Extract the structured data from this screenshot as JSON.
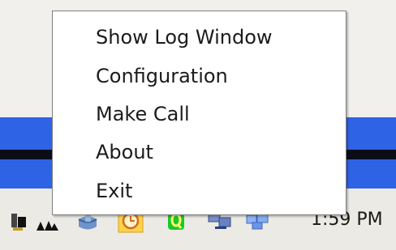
{
  "context_menu": {
    "items": [
      {
        "label": "Show Log Window"
      },
      {
        "label": "Configuration"
      },
      {
        "label": "Make Call"
      },
      {
        "label": "About"
      },
      {
        "label": "Exit"
      }
    ]
  },
  "taskbar": {
    "clock": "1:59 PM",
    "tray_icons": [
      "speaker-icon",
      "network-bars-icon",
      "disk-icon",
      "clock-app-icon",
      "green-q-icon",
      "network-computer-icon",
      "network-computers-icon"
    ]
  },
  "colors": {
    "menu_background": "#ffffff",
    "menu_border": "#7f7f7f",
    "desktop_blue": "#2f63e6",
    "taskbar_background": "#eceae4"
  }
}
